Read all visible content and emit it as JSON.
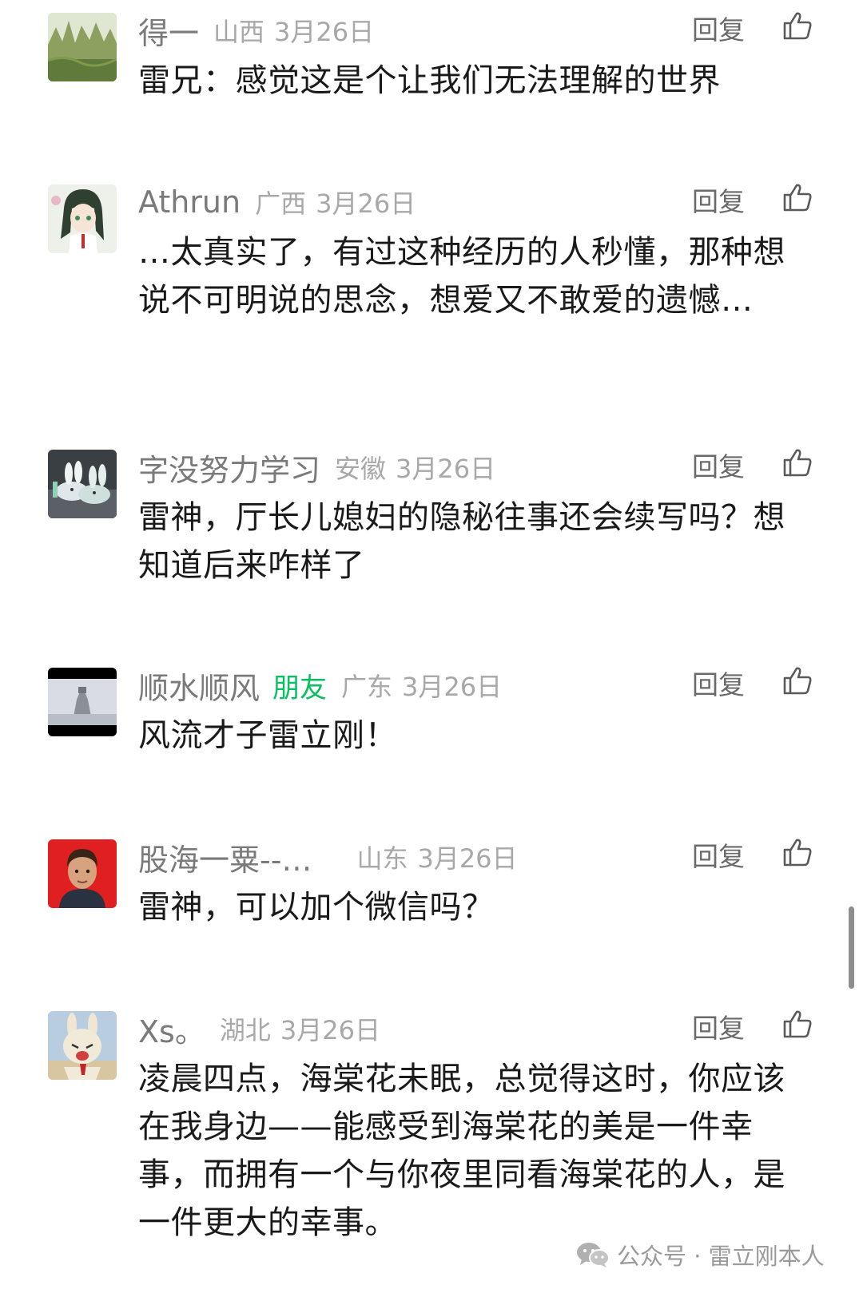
{
  "actions": {
    "reply_label": "回复"
  },
  "comments": [
    {
      "nickname": "得一",
      "location": "山西",
      "date": "3月26日",
      "text": "雷兄：感觉这是个让我们无法理解的世界"
    },
    {
      "nickname": "Athrun",
      "location": "广西",
      "date": "3月26日",
      "text": "…太真实了，有过这种经历的人秒懂，那种想说不可明说的思念，想爱又不敢爱的遗憾…"
    },
    {
      "nickname": "字没努力学习",
      "location": "安徽",
      "date": "3月26日",
      "text": "雷神，厅长儿媳妇的隐秘往事还会续写吗？想知道后来咋样了"
    },
    {
      "nickname": "顺水顺风",
      "tag": "朋友",
      "location": "广东",
      "date": "3月26日",
      "text": "风流才子雷立刚！"
    },
    {
      "nickname": "股海一粟--…",
      "location": "山东",
      "date": "3月26日",
      "text": "雷神，可以加个微信吗？"
    },
    {
      "nickname": "Xs。",
      "location": "湖北",
      "date": "3月26日",
      "text": "凌晨四点，海棠花未眠，总觉得这时，你应该在我身边——能感受到海棠花的美是一件幸事，而拥有一个与你夜里同看海棠花的人，是一件更大的幸事。"
    }
  ],
  "watermark": {
    "icon": "wechat-icon",
    "text": "公众号 · 雷立刚本人"
  },
  "colors": {
    "nickname": "#7a7a7a",
    "meta": "#a8a8a8",
    "friend_tag": "#07c160",
    "body_text": "#1a1a1a",
    "scrollbar": "#8e8e8e"
  }
}
